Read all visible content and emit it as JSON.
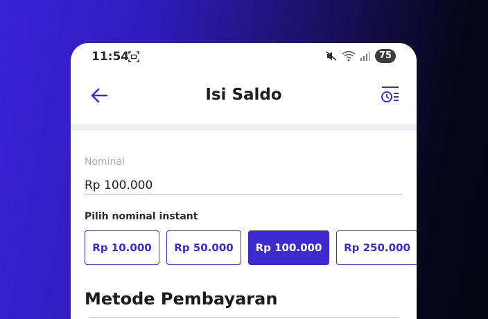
{
  "status_bar": {
    "time": "11:54",
    "battery": "75",
    "icons": [
      "screenshot-icon",
      "mute-icon",
      "wifi-icon",
      "signal-icon"
    ]
  },
  "header": {
    "title": "Isi Saldo",
    "back_icon": "arrow-left-icon",
    "history_icon": "history-list-icon"
  },
  "form": {
    "nominal_label": "Nominal",
    "nominal_value": "Rp 100.000",
    "instant_label": "Pilih nominal instant",
    "chips": [
      {
        "label": "Rp 10.000",
        "selected": false
      },
      {
        "label": "Rp 50.000",
        "selected": false
      },
      {
        "label": "Rp 100.000",
        "selected": true
      },
      {
        "label": "Rp 250.000",
        "selected": false
      }
    ]
  },
  "payment": {
    "title": "Metode Pembayaran"
  },
  "colors": {
    "accent": "#3d2bd0",
    "background_start": "#3a22d8",
    "background_end": "#050511"
  }
}
